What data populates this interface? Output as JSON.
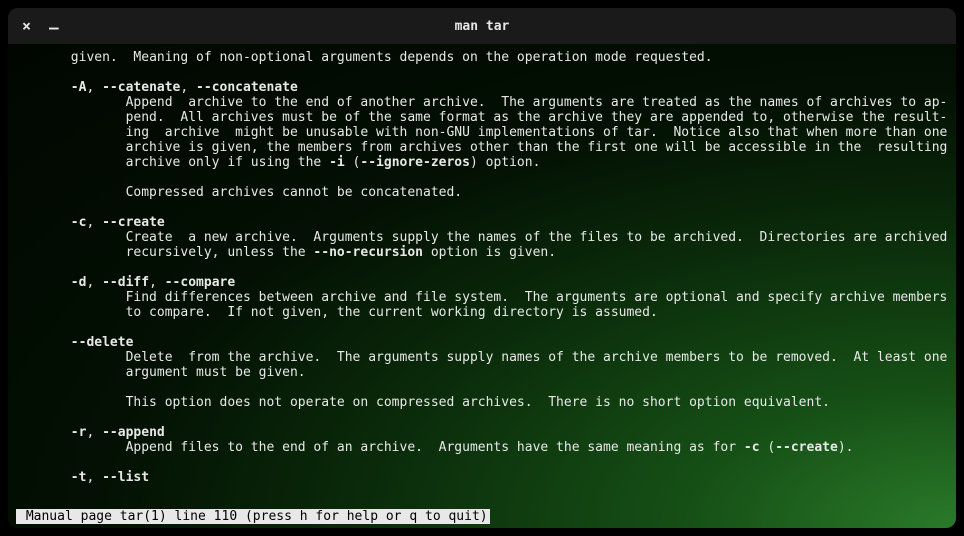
{
  "window": {
    "title": "man tar"
  },
  "lines": [
    {
      "indent": 7,
      "segments": [
        {
          "t": "given.  Meaning of non-optional arguments depends on the operation mode requested."
        }
      ]
    },
    {
      "indent": 0,
      "segments": [
        {
          "t": ""
        }
      ]
    },
    {
      "indent": 7,
      "segments": [
        {
          "t": "-A",
          "b": true
        },
        {
          "t": ", "
        },
        {
          "t": "--catenate",
          "b": true
        },
        {
          "t": ", "
        },
        {
          "t": "--concatenate",
          "b": true
        }
      ]
    },
    {
      "indent": 14,
      "segments": [
        {
          "t": "Append  archive to the end of another archive.  The arguments are treated as the names of archives to ap‐"
        }
      ]
    },
    {
      "indent": 14,
      "segments": [
        {
          "t": "pend.  All archives must be of the same format as the archive they are appended to, otherwise the result‐"
        }
      ]
    },
    {
      "indent": 14,
      "segments": [
        {
          "t": "ing  archive  might be unusable with non-GNU implementations of tar.  Notice also that when more than one"
        }
      ]
    },
    {
      "indent": 14,
      "segments": [
        {
          "t": "archive is given, the members from archives other than the first one will be accessible in the  resulting"
        }
      ]
    },
    {
      "indent": 14,
      "segments": [
        {
          "t": "archive only if using the "
        },
        {
          "t": "-i",
          "b": true
        },
        {
          "t": " ("
        },
        {
          "t": "--ignore-zeros",
          "b": true
        },
        {
          "t": ") option."
        }
      ]
    },
    {
      "indent": 0,
      "segments": [
        {
          "t": ""
        }
      ]
    },
    {
      "indent": 14,
      "segments": [
        {
          "t": "Compressed archives cannot be concatenated."
        }
      ]
    },
    {
      "indent": 0,
      "segments": [
        {
          "t": ""
        }
      ]
    },
    {
      "indent": 7,
      "segments": [
        {
          "t": "-c",
          "b": true
        },
        {
          "t": ", "
        },
        {
          "t": "--create",
          "b": true
        }
      ]
    },
    {
      "indent": 14,
      "segments": [
        {
          "t": "Create  a new archive.  Arguments supply the names of the files to be archived.  Directories are archived"
        }
      ]
    },
    {
      "indent": 14,
      "segments": [
        {
          "t": "recursively, unless the "
        },
        {
          "t": "--no-recursion",
          "b": true
        },
        {
          "t": " option is given."
        }
      ]
    },
    {
      "indent": 0,
      "segments": [
        {
          "t": ""
        }
      ]
    },
    {
      "indent": 7,
      "segments": [
        {
          "t": "-d",
          "b": true
        },
        {
          "t": ", "
        },
        {
          "t": "--diff",
          "b": true
        },
        {
          "t": ", "
        },
        {
          "t": "--compare",
          "b": true
        }
      ]
    },
    {
      "indent": 14,
      "segments": [
        {
          "t": "Find differences between archive and file system.  The arguments are optional and specify archive members"
        }
      ]
    },
    {
      "indent": 14,
      "segments": [
        {
          "t": "to compare.  If not given, the current working directory is assumed."
        }
      ]
    },
    {
      "indent": 0,
      "segments": [
        {
          "t": ""
        }
      ]
    },
    {
      "indent": 7,
      "segments": [
        {
          "t": "--delete",
          "b": true
        }
      ]
    },
    {
      "indent": 14,
      "segments": [
        {
          "t": "Delete  from the archive.  The arguments supply names of the archive members to be removed.  At least one"
        }
      ]
    },
    {
      "indent": 14,
      "segments": [
        {
          "t": "argument must be given."
        }
      ]
    },
    {
      "indent": 0,
      "segments": [
        {
          "t": ""
        }
      ]
    },
    {
      "indent": 14,
      "segments": [
        {
          "t": "This option does not operate on compressed archives.  There is no short option equivalent."
        }
      ]
    },
    {
      "indent": 0,
      "segments": [
        {
          "t": ""
        }
      ]
    },
    {
      "indent": 7,
      "segments": [
        {
          "t": "-r",
          "b": true
        },
        {
          "t": ", "
        },
        {
          "t": "--append",
          "b": true
        }
      ]
    },
    {
      "indent": 14,
      "segments": [
        {
          "t": "Append files to the end of an archive.  Arguments have the same meaning as for "
        },
        {
          "t": "-c",
          "b": true
        },
        {
          "t": " ("
        },
        {
          "t": "--create",
          "b": true
        },
        {
          "t": ")."
        }
      ]
    },
    {
      "indent": 0,
      "segments": [
        {
          "t": ""
        }
      ]
    },
    {
      "indent": 7,
      "segments": [
        {
          "t": "-t",
          "b": true
        },
        {
          "t": ", "
        },
        {
          "t": "--list",
          "b": true
        }
      ]
    }
  ],
  "status": " Manual page tar(1) line 110 (press h for help or q to quit)"
}
